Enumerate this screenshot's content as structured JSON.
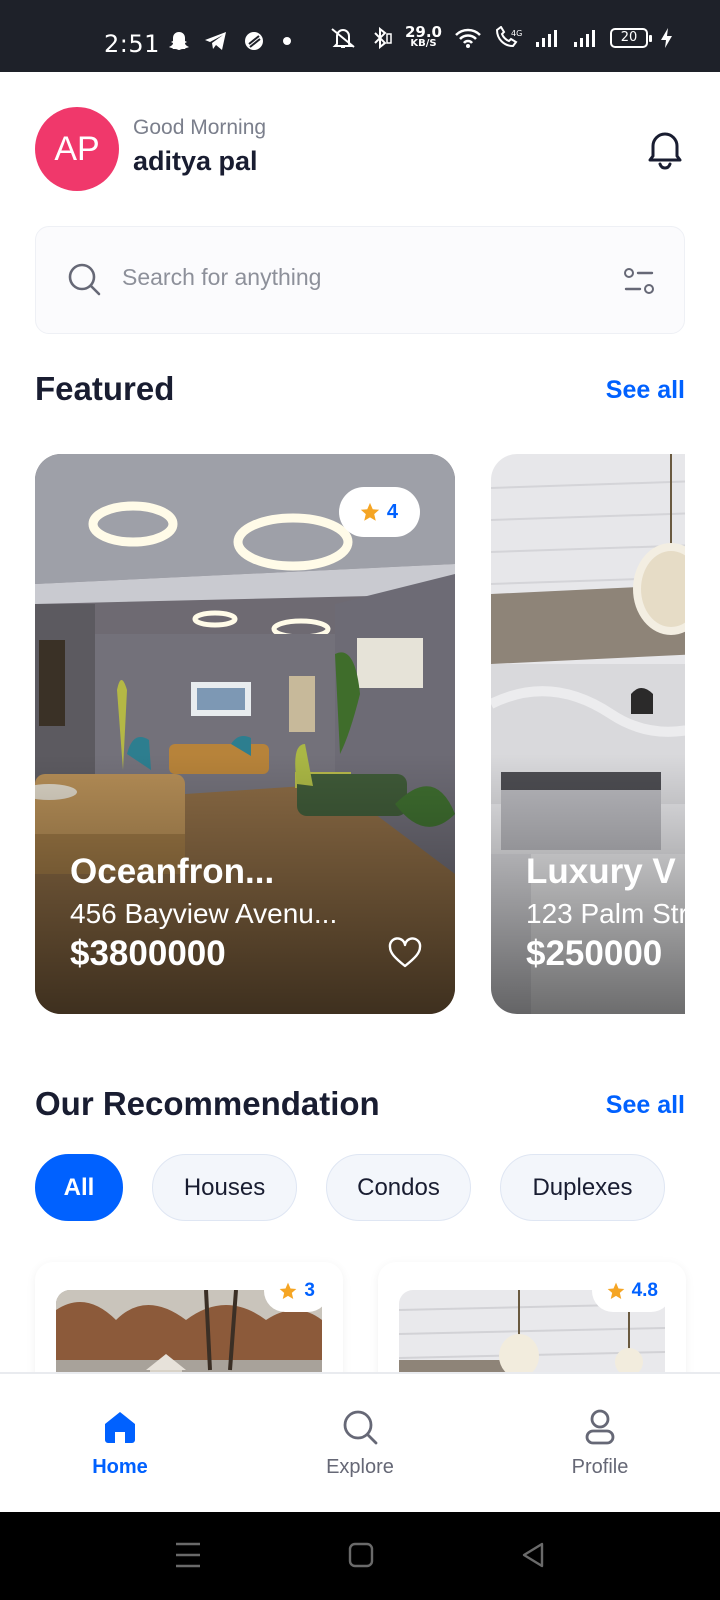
{
  "status_bar": {
    "time": "2:51",
    "net_speed_value": "29.0",
    "net_speed_unit": "KB/S",
    "battery": "20"
  },
  "header": {
    "avatar_initials": "AP",
    "greeting": "Good Morning",
    "user_name": "aditya pal"
  },
  "search": {
    "placeholder": "Search for anything"
  },
  "featured": {
    "title": "Featured",
    "see_all": "See all",
    "cards": [
      {
        "name": "Oceanfron...",
        "address": "456 Bayview Avenu...",
        "price": "$3800000",
        "rating": "4"
      },
      {
        "name": "Luxury V",
        "address": "123 Palm Str",
        "price": "$250000"
      }
    ]
  },
  "recommendation": {
    "title": "Our Recommendation",
    "see_all": "See all",
    "filters": [
      "All",
      "Houses",
      "Condos",
      "Duplexes"
    ],
    "active_filter": "All",
    "cards": [
      {
        "rating": "3"
      },
      {
        "rating": "4.8"
      }
    ]
  },
  "bottom_nav": {
    "items": [
      {
        "label": "Home",
        "icon": "home-icon",
        "active": true
      },
      {
        "label": "Explore",
        "icon": "search-icon",
        "active": false
      },
      {
        "label": "Profile",
        "icon": "person-icon",
        "active": false
      }
    ]
  },
  "colors": {
    "primary": "#0061ff",
    "avatar": "#f0386b",
    "star": "#f5a524",
    "text_dark": "#191d31"
  }
}
